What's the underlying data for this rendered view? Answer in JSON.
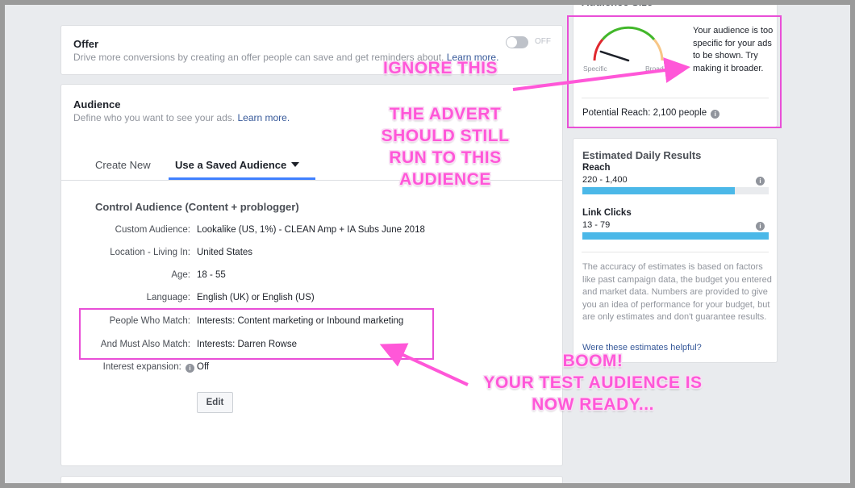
{
  "offer": {
    "title": "Offer",
    "subtitle": "Drive more conversions by creating an offer people can save and get reminders about.",
    "learn_more": "Learn more.",
    "toggle_state": "OFF"
  },
  "audience": {
    "title": "Audience",
    "subtitle": "Define who you want to see your ads.",
    "learn_more": "Learn more.",
    "tabs": [
      {
        "label": "Create New",
        "active": false
      },
      {
        "label": "Use a Saved Audience",
        "active": true
      }
    ],
    "saved_name": "Control Audience (Content + problogger)",
    "rows": [
      {
        "label": "Custom Audience:",
        "value": "Lookalike (US, 1%) - CLEAN Amp + IA Subs June 2018"
      },
      {
        "label": "Location - Living In:",
        "value": "United States"
      },
      {
        "label": "Age:",
        "value": "18 - 55"
      },
      {
        "label": "Language:",
        "value": "English (UK) or English (US)"
      },
      {
        "label": "People Who Match:",
        "value": "Interests: Content marketing or Inbound marketing"
      },
      {
        "label": "And Must Also Match:",
        "value": "Interests: Darren Rowse"
      },
      {
        "label": "Interest expansion:",
        "value": "Off"
      }
    ],
    "edit_label": "Edit"
  },
  "audience_size": {
    "title": "Audience Size",
    "message": "Your audience is too specific for your ads to be shown. Try making it broader.",
    "gauge_left": "Specific",
    "gauge_right": "Broad",
    "gauge_level": 0.1,
    "potential_reach": "Potential Reach: 2,100 people"
  },
  "daily_results": {
    "title": "Estimated Daily Results",
    "metrics": [
      {
        "label": "Reach",
        "value": "220 - 1,400",
        "fill": 0.82
      },
      {
        "label": "Link Clicks",
        "value": "13 - 79",
        "fill": 1.0
      }
    ],
    "note": "The accuracy of estimates is based on factors like past campaign data, the budget you entered and market data. Numbers are provided to give you an idea of performance for your budget, but are only estimates and don't guarantee results.",
    "helpful_link": "Were these estimates helpful?"
  },
  "annotations": {
    "ignore": "IGNORE THIS",
    "advert": [
      "THE ADVERT",
      "SHOULD STILL",
      "RUN TO THIS",
      "AUDIENCE"
    ],
    "boom": [
      "BOOM!",
      "YOUR TEST AUDIENCE IS",
      "NOW READY..."
    ]
  },
  "colors": {
    "annotation_pink": "#ff57d8",
    "link_blue": "#365899",
    "bar_blue": "#4bb8e8",
    "tab_underline": "#4080ff"
  }
}
